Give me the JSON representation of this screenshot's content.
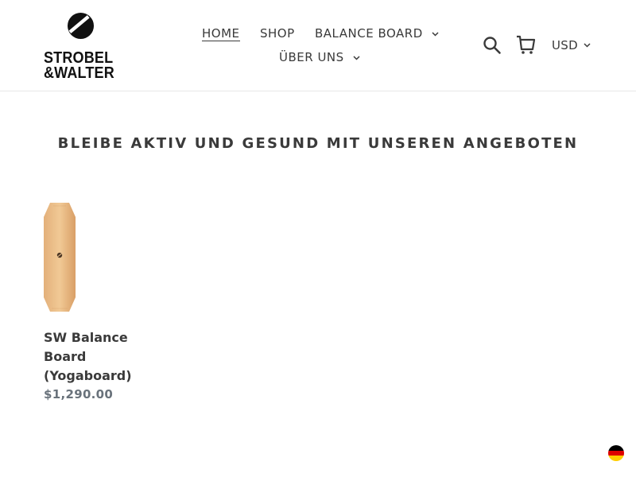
{
  "brand": {
    "logo_line1": "STROBEL",
    "logo_line2": "&WALTER"
  },
  "nav": {
    "items": [
      {
        "label": "HOME",
        "active": true
      },
      {
        "label": "SHOP"
      },
      {
        "label": "BALANCE BOARD",
        "has_dropdown": true
      },
      {
        "label": "ÜBER UNS",
        "has_dropdown": true
      }
    ]
  },
  "header_icons": [
    "search-icon",
    "cart-icon"
  ],
  "currency": {
    "selected": "USD"
  },
  "section": {
    "title": "BLEIBE AKTIV UND GESUND MIT UNSEREN ANGEBOTEN"
  },
  "products": [
    {
      "title": "SW Balance Board (Yogaboard)",
      "price": "$1,290.00"
    }
  ],
  "language_flag": "german-flag-icon",
  "colors": {
    "text": "#3a3a3a",
    "price": "#69727b",
    "wood": "#d9a877"
  }
}
